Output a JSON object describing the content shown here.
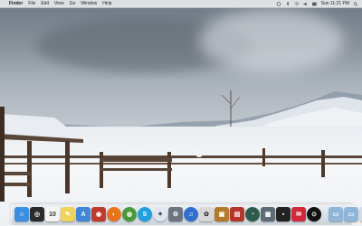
{
  "menubar": {
    "apple_symbol": "",
    "app_name": "Finder",
    "menus": [
      "File",
      "Edit",
      "View",
      "Go",
      "Window",
      "Help"
    ],
    "clock": "Sun 11:21 PM",
    "status_icons": [
      "time-machine-icon",
      "bluetooth-icon",
      "wifi-icon",
      "volume-icon",
      "battery-icon",
      "spotlight-icon"
    ]
  },
  "desktop": {
    "wallpaper": "snowy-landscape-with-fence-and-gazebo"
  },
  "dock": {
    "apps": [
      {
        "name": "finder",
        "glyph": "☺",
        "color": "#3b8fe0"
      },
      {
        "name": "dashboard",
        "glyph": "◎",
        "color": "#2b2b2b"
      },
      {
        "name": "calendar",
        "glyph": "10",
        "color": "#f4f4f4"
      },
      {
        "name": "notes",
        "glyph": "✎",
        "color": "#f1d35a"
      },
      {
        "name": "app-store",
        "glyph": "A",
        "color": "#3f86d8"
      },
      {
        "name": "photo-booth",
        "glyph": "◉",
        "color": "#c03a2b"
      },
      {
        "name": "firefox",
        "glyph": "◐",
        "color": "#e8731c"
      },
      {
        "name": "chrome",
        "glyph": "◍",
        "color": "#4a9a3c"
      },
      {
        "name": "skype",
        "glyph": "S",
        "color": "#1fa0e3"
      },
      {
        "name": "safari",
        "glyph": "✦",
        "color": "#dfe6ee"
      },
      {
        "name": "system-preferences",
        "glyph": "⚙",
        "color": "#6d7480"
      },
      {
        "name": "itunes",
        "glyph": "♫",
        "color": "#2e6fd0"
      },
      {
        "name": "iphoto",
        "glyph": "✿",
        "color": "#d8d8d8"
      },
      {
        "name": "preview",
        "glyph": "▣",
        "color": "#b47a2a"
      },
      {
        "name": "photoshop",
        "glyph": "▤",
        "color": "#b8342a"
      },
      {
        "name": "time-machine",
        "glyph": "◔",
        "color": "#2c5d4c"
      },
      {
        "name": "vmware",
        "glyph": "▦",
        "color": "#5f6b75"
      },
      {
        "name": "terminal",
        "glyph": "▪",
        "color": "#222"
      },
      {
        "name": "mail",
        "glyph": "✉",
        "color": "#d22a3a"
      },
      {
        "name": "unknown-app",
        "glyph": "⊙",
        "color": "#111"
      }
    ],
    "folders": [
      {
        "name": "applications-folder",
        "glyph": "▭",
        "color": "#8fb6d8"
      },
      {
        "name": "documents-folder",
        "glyph": "▭",
        "color": "#8fb6d8"
      }
    ],
    "trash": {
      "name": "trash",
      "glyph": "♲",
      "color": "#d6dbe0"
    }
  }
}
